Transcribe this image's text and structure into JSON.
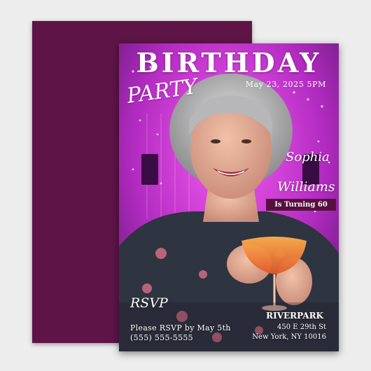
{
  "invitation": {
    "title": "BIRTHDAY",
    "subtitle": "PARTY",
    "date": "May 23, 2025 5PM",
    "first_name": "Sophia",
    "last_name": "Williams",
    "turning": "Is Turning 60",
    "rsvp_heading": "RSVP",
    "rsvp_line": "Please RSVP by May 5th",
    "phone": "(555) 555-5555",
    "venue": "RIVERPARK",
    "address_line1": "450 E 29th St",
    "address_line2": "New York, NY 10016"
  },
  "colors": {
    "back_card": "#5e1447",
    "label_band": "#56103e",
    "neon": "#e033e8",
    "text": "#ffffff"
  }
}
